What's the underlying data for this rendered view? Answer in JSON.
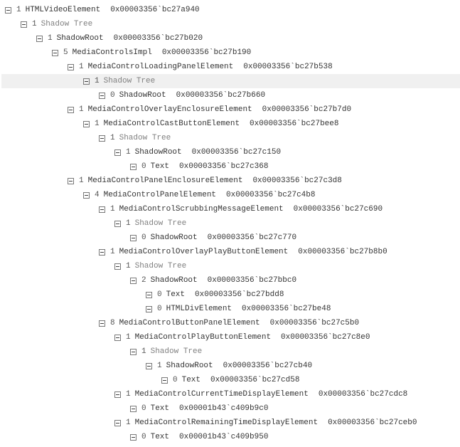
{
  "tree": [
    {
      "indent": 0,
      "toggle": true,
      "count": "1",
      "name": "HTMLVideoElement",
      "shadow": false,
      "addr": "0x00003356`bc27a940",
      "hl": false
    },
    {
      "indent": 1,
      "toggle": true,
      "count": "1",
      "name": "Shadow Tree",
      "shadow": true,
      "addr": "",
      "hl": false
    },
    {
      "indent": 2,
      "toggle": true,
      "count": "1",
      "name": "ShadowRoot",
      "shadow": false,
      "addr": "0x00003356`bc27b020",
      "hl": false
    },
    {
      "indent": 3,
      "toggle": true,
      "count": "5",
      "name": "MediaControlsImpl",
      "shadow": false,
      "addr": "0x00003356`bc27b190",
      "hl": false
    },
    {
      "indent": 4,
      "toggle": true,
      "count": "1",
      "name": "MediaControlLoadingPanelElement",
      "shadow": false,
      "addr": "0x00003356`bc27b538",
      "hl": false
    },
    {
      "indent": 5,
      "toggle": true,
      "count": "1",
      "name": "Shadow Tree",
      "shadow": true,
      "addr": "",
      "hl": true
    },
    {
      "indent": 6,
      "toggle": true,
      "count": "0",
      "name": "ShadowRoot",
      "shadow": false,
      "addr": "0x00003356`bc27b660",
      "hl": false
    },
    {
      "indent": 4,
      "toggle": true,
      "count": "1",
      "name": "MediaControlOverlayEnclosureElement",
      "shadow": false,
      "addr": "0x00003356`bc27b7d0",
      "hl": false
    },
    {
      "indent": 5,
      "toggle": true,
      "count": "1",
      "name": "MediaControlCastButtonElement",
      "shadow": false,
      "addr": "0x00003356`bc27bee8",
      "hl": false
    },
    {
      "indent": 6,
      "toggle": true,
      "count": "1",
      "name": "Shadow Tree",
      "shadow": true,
      "addr": "",
      "hl": false
    },
    {
      "indent": 7,
      "toggle": true,
      "count": "1",
      "name": "ShadowRoot",
      "shadow": false,
      "addr": "0x00003356`bc27c150",
      "hl": false
    },
    {
      "indent": 8,
      "toggle": true,
      "count": "0",
      "name": "Text",
      "shadow": false,
      "addr": "0x00003356`bc27c368",
      "hl": false
    },
    {
      "indent": 4,
      "toggle": true,
      "count": "1",
      "name": "MediaControlPanelEnclosureElement",
      "shadow": false,
      "addr": "0x00003356`bc27c3d8",
      "hl": false
    },
    {
      "indent": 5,
      "toggle": true,
      "count": "4",
      "name": "MediaControlPanelElement",
      "shadow": false,
      "addr": "0x00003356`bc27c4b8",
      "hl": false
    },
    {
      "indent": 6,
      "toggle": true,
      "count": "1",
      "name": "MediaControlScrubbingMessageElement",
      "shadow": false,
      "addr": "0x00003356`bc27c690",
      "hl": false
    },
    {
      "indent": 7,
      "toggle": true,
      "count": "1",
      "name": "Shadow Tree",
      "shadow": true,
      "addr": "",
      "hl": false
    },
    {
      "indent": 8,
      "toggle": true,
      "count": "0",
      "name": "ShadowRoot",
      "shadow": false,
      "addr": "0x00003356`bc27c770",
      "hl": false
    },
    {
      "indent": 6,
      "toggle": true,
      "count": "1",
      "name": "MediaControlOverlayPlayButtonElement",
      "shadow": false,
      "addr": "0x00003356`bc27b8b0",
      "hl": false
    },
    {
      "indent": 7,
      "toggle": true,
      "count": "1",
      "name": "Shadow Tree",
      "shadow": true,
      "addr": "",
      "hl": false
    },
    {
      "indent": 8,
      "toggle": true,
      "count": "2",
      "name": "ShadowRoot",
      "shadow": false,
      "addr": "0x00003356`bc27bbc0",
      "hl": false
    },
    {
      "indent": 9,
      "toggle": true,
      "count": "0",
      "name": "Text",
      "shadow": false,
      "addr": "0x00003356`bc27bdd8",
      "hl": false
    },
    {
      "indent": 9,
      "toggle": true,
      "count": "0",
      "name": "HTMLDivElement",
      "shadow": false,
      "addr": "0x00003356`bc27be48",
      "hl": false
    },
    {
      "indent": 6,
      "toggle": true,
      "count": "8",
      "name": "MediaControlButtonPanelElement",
      "shadow": false,
      "addr": "0x00003356`bc27c5b0",
      "hl": false
    },
    {
      "indent": 7,
      "toggle": true,
      "count": "1",
      "name": "MediaControlPlayButtonElement",
      "shadow": false,
      "addr": "0x00003356`bc27c8e0",
      "hl": false
    },
    {
      "indent": 8,
      "toggle": true,
      "count": "1",
      "name": "Shadow Tree",
      "shadow": true,
      "addr": "",
      "hl": false
    },
    {
      "indent": 9,
      "toggle": true,
      "count": "1",
      "name": "ShadowRoot",
      "shadow": false,
      "addr": "0x00003356`bc27cb40",
      "hl": false
    },
    {
      "indent": 10,
      "toggle": true,
      "count": "0",
      "name": "Text",
      "shadow": false,
      "addr": "0x00003356`bc27cd58",
      "hl": false
    },
    {
      "indent": 7,
      "toggle": true,
      "count": "1",
      "name": "MediaControlCurrentTimeDisplayElement",
      "shadow": false,
      "addr": "0x00003356`bc27cdc8",
      "hl": false
    },
    {
      "indent": 8,
      "toggle": true,
      "count": "0",
      "name": "Text",
      "shadow": false,
      "addr": "0x00001b43`c409b9c0",
      "hl": false
    },
    {
      "indent": 7,
      "toggle": true,
      "count": "1",
      "name": "MediaControlRemainingTimeDisplayElement",
      "shadow": false,
      "addr": "0x00003356`bc27ceb0",
      "hl": false
    },
    {
      "indent": 8,
      "toggle": true,
      "count": "0",
      "name": "Text",
      "shadow": false,
      "addr": "0x00001b43`c409b950",
      "hl": false
    }
  ]
}
